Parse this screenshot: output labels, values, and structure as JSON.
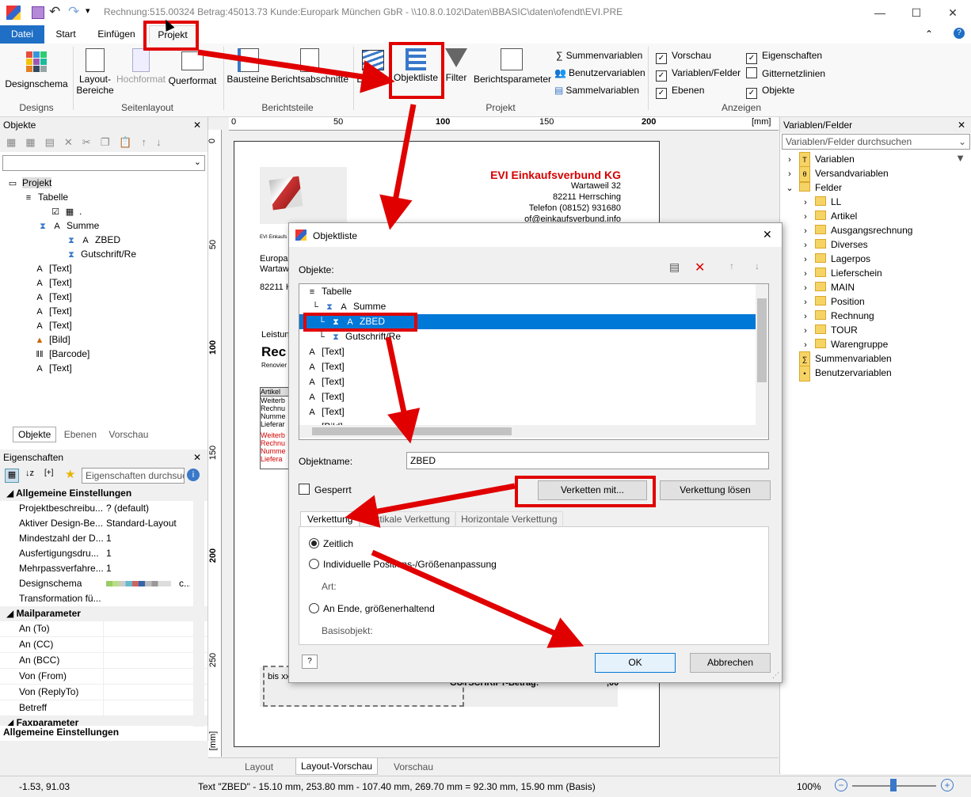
{
  "titlebar": {
    "title": "Rechnung:515.00324 Betrag:45013.73 Kunde:Europark München GbR - \\\\10.8.0.102\\Daten\\BBASIC\\daten\\ofendt\\EVI.PRE",
    "minimize": "—",
    "maximize": "☐",
    "close": "✕"
  },
  "ribbon_tabs": [
    {
      "label": "Datei"
    },
    {
      "label": "Start"
    },
    {
      "label": "Einfügen"
    },
    {
      "label": "Projekt"
    }
  ],
  "ribbon": {
    "designschema": "Designschema",
    "layout_bereiche_1": "Layout-",
    "layout_bereiche_2": "Bereiche",
    "hochformat": "Hochformat",
    "querformat": "Querformat",
    "bausteine": "Bausteine",
    "berichtsabschnitte": "Berichtsabschnitte",
    "ebenen": "Ebenen",
    "objektliste": "Objektliste",
    "filter": "Filter",
    "berichtsparameter": "Berichtsparameter",
    "summenvariablen": "Summenvariablen",
    "benutzervariablen": "Benutzervariablen",
    "sammelvariablen": "Sammelvariablen",
    "vorschau": "Vorschau",
    "variablen_felder": "Variablen/Felder",
    "ebenen_chk": "Ebenen",
    "eigenschaften": "Eigenschaften",
    "gitternetzlinien": "Gitternetzlinien",
    "objekte": "Objekte",
    "groups": {
      "designs": "Designs",
      "seitenlayout": "Seitenlayout",
      "berichtsteile": "Berichtsteile",
      "projekt": "Projekt",
      "anzeigen": "Anzeigen"
    }
  },
  "objekte_panel": {
    "title": "Objekte",
    "close": "✕",
    "tree": [
      {
        "label": "Projekt"
      },
      {
        "label": "Tabelle"
      },
      {
        "label": "."
      },
      {
        "label": "Summe"
      },
      {
        "label": "ZBED"
      },
      {
        "label": "Gutschrift/Re"
      },
      {
        "label": "[Text]"
      },
      {
        "label": "[Text]"
      },
      {
        "label": "[Text]"
      },
      {
        "label": "[Text]"
      },
      {
        "label": "[Text]"
      },
      {
        "label": "[Bild]"
      },
      {
        "label": "[Barcode]"
      },
      {
        "label": "[Text]"
      }
    ],
    "tabs": [
      "Objekte",
      "Ebenen",
      "Vorschau"
    ]
  },
  "eigenschaften_panel": {
    "title": "Eigenschaften",
    "search_placeholder": "Eigenschaften durchsuchen",
    "section1": "Allgemeine Einstellungen",
    "rows": [
      {
        "name": "Projektbeschreibu...",
        "value": "? (default)"
      },
      {
        "name": "Aktiver Design-Be...",
        "value": "Standard-Layout"
      },
      {
        "name": "Mindestzahl der D...",
        "value": "1"
      },
      {
        "name": "Ausfertigungsdru...",
        "value": "1"
      },
      {
        "name": "Mehrpassverfahre...",
        "value": "1"
      },
      {
        "name": "Designschema",
        "value": "c..."
      },
      {
        "name": "Transformation fü...",
        "value": ""
      }
    ],
    "section2": "Mailparameter",
    "mail_rows": [
      "An (To)",
      "An (CC)",
      "An (BCC)",
      "Von (From)",
      "Von (ReplyTo)",
      "Betreff"
    ],
    "section3": "Faxparameter",
    "footer": "Allgemeine Einstellungen"
  },
  "ruler": {
    "unit": "[mm]",
    "top": [
      "0",
      "50",
      "100",
      "150",
      "200"
    ],
    "left": [
      "0",
      "50",
      "100",
      "150",
      "200",
      "250"
    ]
  },
  "page": {
    "company": "EVI Einkaufsverbund KG",
    "street": "Wartaweil 32",
    "city": "82211 Herrsching",
    "phone": "Telefon (08152) 931680",
    "email": "of@einkaufsverbund.info",
    "small_sender": "EVI Einkaufs",
    "addr1": "Europa",
    "addr2": "Wartaw",
    "addr3": "82211 H",
    "leistung": "Leistun",
    "rec": "Rec",
    "renov": "Renovier",
    "table_head": "Artikel",
    "t1": "Weiterb",
    "t2": "Rechnu",
    "t3": "Numme",
    "t4": "Lieferar",
    "r1": "Weiterb",
    "r2": "Rechnu",
    "r3": "Numme",
    "r4": "Liefera",
    "bis": "bis xx",
    "gutschrift": "GUTSCHRIFT-Betrag:",
    "amount": ",00"
  },
  "bottom_tabs": [
    "Layout",
    "Layout-Vorschau",
    "Vorschau"
  ],
  "variablen_panel": {
    "title": "Variablen/Felder",
    "search_placeholder": "Variablen/Felder durchsuchen",
    "items": [
      {
        "label": "Variablen"
      },
      {
        "label": "Versandvariablen"
      },
      {
        "label": "Felder"
      },
      {
        "label": "LL"
      },
      {
        "label": "Artikel"
      },
      {
        "label": "Ausgangsrechnung"
      },
      {
        "label": "Diverses"
      },
      {
        "label": "Lagerpos"
      },
      {
        "label": "Lieferschein"
      },
      {
        "label": "MAIN"
      },
      {
        "label": "Position"
      },
      {
        "label": "Rechnung"
      },
      {
        "label": "TOUR"
      },
      {
        "label": "Warengruppe"
      },
      {
        "label": "Summenvariablen"
      },
      {
        "label": "Benutzervariablen"
      }
    ]
  },
  "dialog": {
    "title": "Objektliste",
    "objekte_label": "Objekte:",
    "list": [
      {
        "label": "Tabelle"
      },
      {
        "label": "Summe"
      },
      {
        "label": "ZBED"
      },
      {
        "label": "Gutschrift/Re"
      },
      {
        "label": "[Text]"
      },
      {
        "label": "[Text]"
      },
      {
        "label": "[Text]"
      },
      {
        "label": "[Text]"
      },
      {
        "label": "[Text]"
      },
      {
        "label": "[Bild]"
      }
    ],
    "objektname_label": "Objektname:",
    "objektname_value": "ZBED",
    "gesperrt": "Gesperrt",
    "verketten": "Verketten mit...",
    "verkettung_loesen": "Verkettung lösen",
    "tabs": [
      "Verkettung",
      "Vertikale Verkettung",
      "Horizontale Verkettung"
    ],
    "zeitlich": "Zeitlich",
    "individuelle": "Individuelle Positions-/Größenanpassung",
    "art": "Art:",
    "an_ende": "An Ende, größenerhaltend",
    "basisobjekt": "Basisobjekt:",
    "ok": "OK",
    "abbrechen": "Abbrechen",
    "help": "?"
  },
  "statusbar": {
    "coords": "-1.53, 91.03",
    "info": "Text \"ZBED\" - 15.10 mm, 253.80 mm - 107.40 mm, 269.70 mm = 92.30 mm, 15.90 mm (Basis)",
    "zoom": "100%",
    "minus": "−",
    "plus": "+"
  },
  "colors": {
    "accent": "#1e6fc5",
    "highlight_red": "#e00000",
    "selection": "#0078d7"
  }
}
